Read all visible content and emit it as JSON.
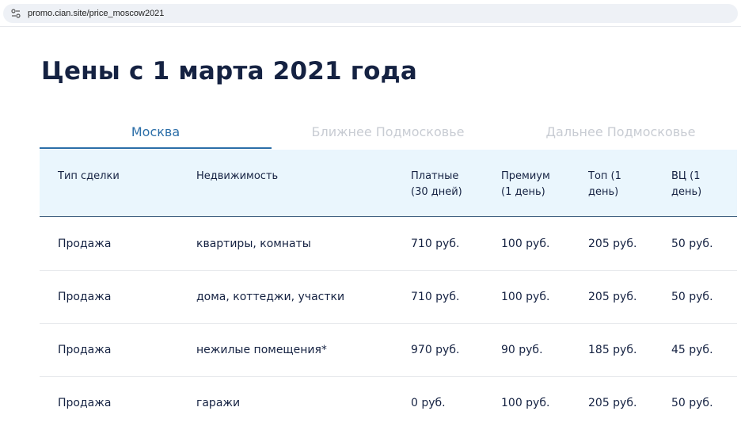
{
  "browser": {
    "url": "promo.cian.site/price_moscow2021"
  },
  "page": {
    "title": "Цены с 1 марта 2021 года"
  },
  "tabs": [
    {
      "label": "Москва",
      "active": true
    },
    {
      "label": "Ближнее Подмосковье",
      "active": false
    },
    {
      "label": "Дальнее Подмосковье",
      "active": false
    }
  ],
  "table": {
    "headers": [
      [
        "Тип сделки"
      ],
      [
        "Недвижимость"
      ],
      [
        "Платные",
        "(30 дней)"
      ],
      [
        "Премиум",
        "(1 день)"
      ],
      [
        "Топ (1",
        "день)"
      ],
      [
        "ВЦ (1",
        "день)"
      ]
    ],
    "rows": [
      [
        "Продажа",
        "квартиры, комнаты",
        "710 руб.",
        "100 руб.",
        "205 руб.",
        "50 руб."
      ],
      [
        "Продажа",
        "дома, коттеджи, участки",
        "710 руб.",
        "100 руб.",
        "205 руб.",
        "50 руб."
      ],
      [
        "Продажа",
        "нежилые помещения*",
        "970 руб.",
        "90 руб.",
        "185 руб.",
        "45 руб."
      ],
      [
        "Продажа",
        "гаражи",
        "0 руб.",
        "100 руб.",
        "205 руб.",
        "50 руб."
      ]
    ]
  },
  "colors": {
    "accent": "#2b6ea8",
    "header_bg": "#eaf6fd",
    "text": "#152242"
  },
  "icons": {
    "site_info": "tune-icon"
  }
}
